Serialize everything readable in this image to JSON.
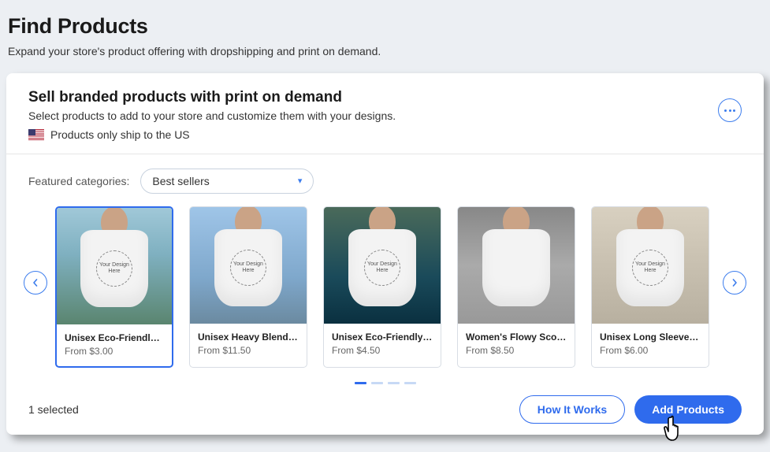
{
  "page": {
    "title": "Find Products",
    "subtitle": "Expand your store's product offering with dropshipping and print on demand."
  },
  "card": {
    "title": "Sell branded products with print on demand",
    "subtitle": "Select products to add to your store and customize them with your designs.",
    "ship_note": "Products only ship to the US"
  },
  "filter": {
    "label": "Featured categories:",
    "selected": "Best sellers"
  },
  "design_placeholder": "Your Design Here",
  "products": [
    {
      "name": "Unisex Eco-Friendly He...",
      "price": "From $3.00",
      "selected": true,
      "bg": "bg-palm"
    },
    {
      "name": "Unisex Heavy Blend H...",
      "price": "From $11.50",
      "selected": false,
      "bg": "bg-sky"
    },
    {
      "name": "Unisex Eco-Friendly Co...",
      "price": "From $4.50",
      "selected": false,
      "bg": "bg-pool"
    },
    {
      "name": "Women's Flowy Scoop ...",
      "price": "From $8.50",
      "selected": false,
      "bg": "bg-steps"
    },
    {
      "name": "Unisex Long Sleeve T-...",
      "price": "From $6.00",
      "selected": false,
      "bg": "bg-wall"
    }
  ],
  "pager": {
    "total": 4,
    "active": 0
  },
  "footer": {
    "selected_text": "1 selected",
    "how_it_works": "How It Works",
    "add_products": "Add Products"
  }
}
